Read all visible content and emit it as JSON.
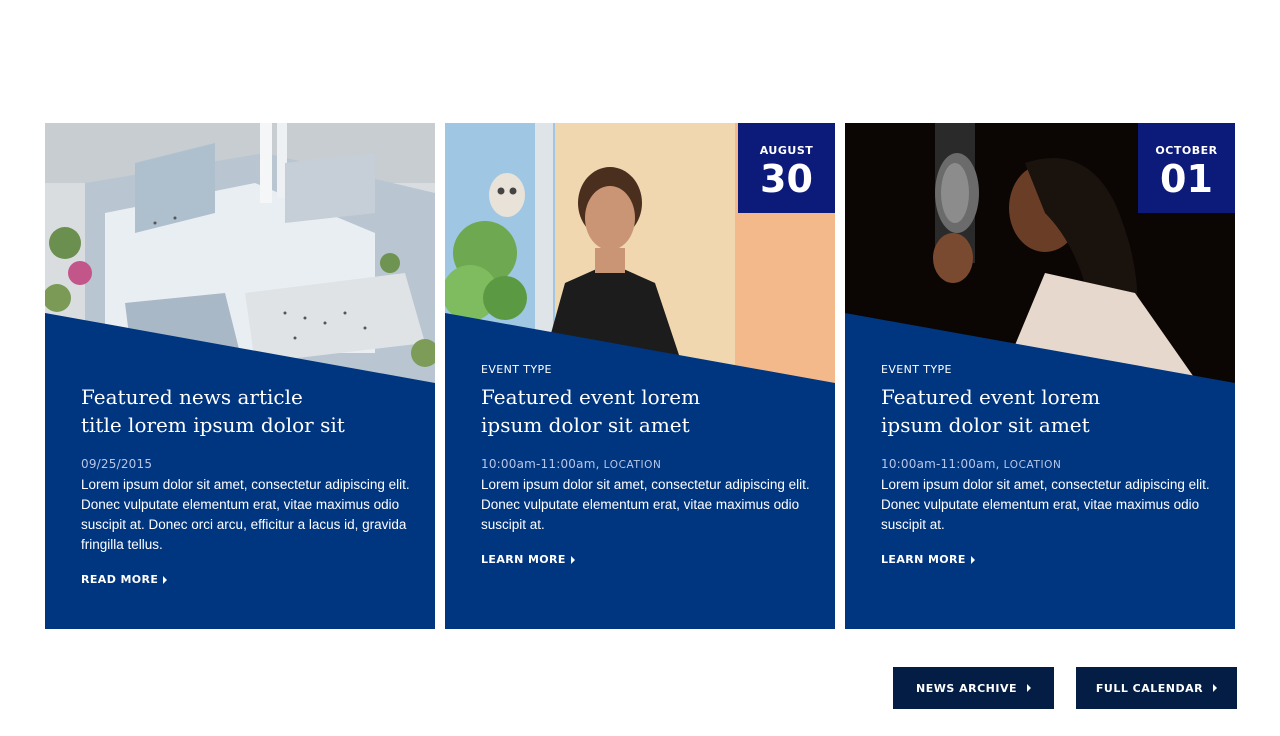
{
  "cards": [
    {
      "type": "news",
      "title_line1": "Featured news article",
      "title_line2": "title lorem ipsum dolor sit",
      "date": "09/25/2015",
      "text": "Lorem ipsum dolor sit amet, consectetur adipiscing elit. Donec vulputate elementum erat, vitae maximus odio suscipit at. Donec orci arcu, efficitur a lacus id, gravida fringilla tellus.",
      "link": "READ MORE",
      "image": "aerial-building-rendering"
    },
    {
      "type": "event",
      "badge_month": "AUGUST",
      "badge_day": "30",
      "event_type": "EVENT TYPE",
      "title_line1": "Featured event lorem",
      "title_line2": "ipsum dolor sit amet",
      "time": "10:00am-11:00am,",
      "location": "LOCATION",
      "text": "Lorem ipsum dolor sit amet, consectetur adipiscing elit. Donec vulputate elementum erat, vitae maximus odio suscipit at.",
      "link": "LEARN MORE",
      "image": "artist-portrait"
    },
    {
      "type": "event",
      "badge_month": "OCTOBER",
      "badge_day": "01",
      "event_type": "EVENT TYPE",
      "title_line1": "Featured event lorem",
      "title_line2": "ipsum dolor sit amet",
      "time": "10:00am-11:00am,",
      "location": "LOCATION",
      "text": "Lorem ipsum dolor sit amet, consectetur adipiscing elit. Donec vulputate elementum erat, vitae maximus odio suscipit at.",
      "link": "LEARN MORE",
      "image": "singer-at-microphone"
    }
  ],
  "buttons": {
    "news_archive": "NEWS ARCHIVE",
    "full_calendar": "FULL CALENDAR"
  },
  "colors": {
    "card_blue": "#00357f",
    "badge_blue": "#0c1a7a",
    "button_navy": "#041d45"
  }
}
